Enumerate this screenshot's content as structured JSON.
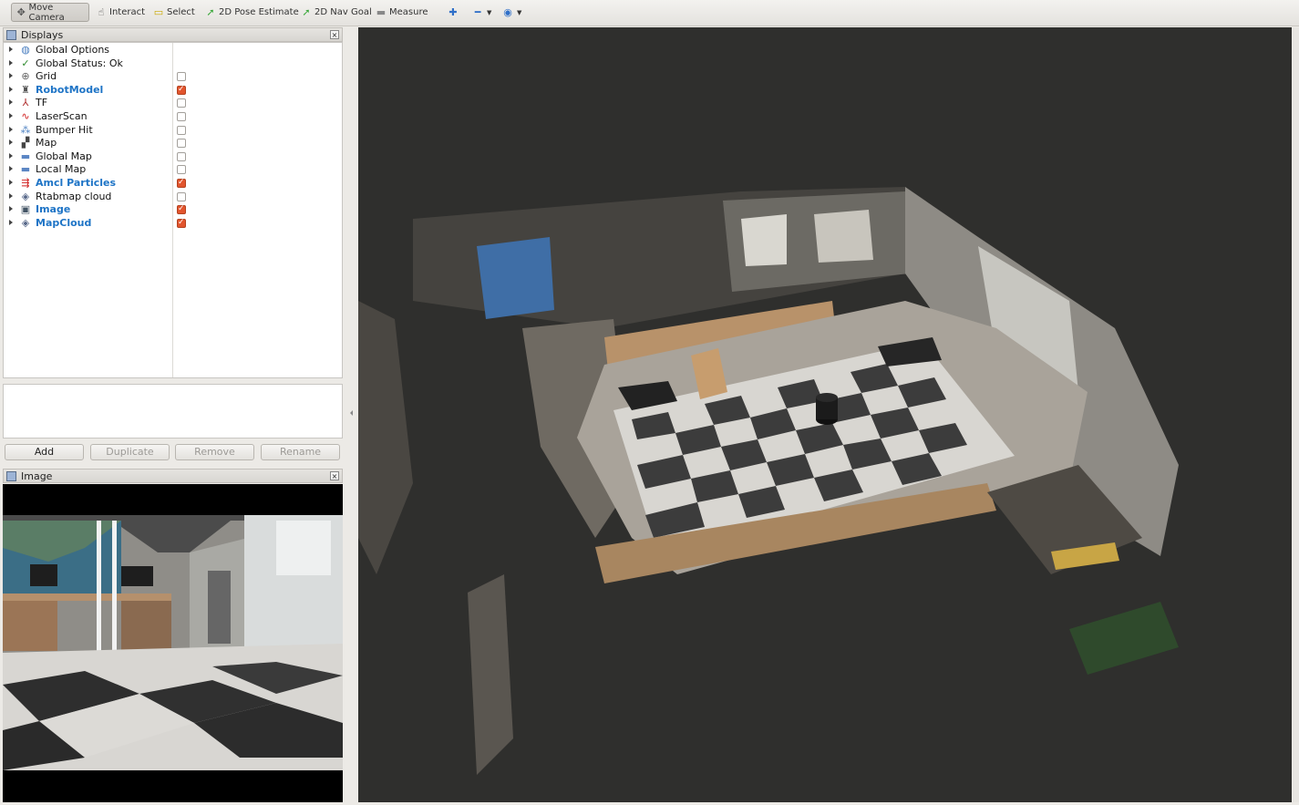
{
  "toolbar": {
    "tools": [
      {
        "label": "Move Camera",
        "icon": "move-camera-icon",
        "glyph": "✥",
        "color": "#555555",
        "active": true
      },
      {
        "label": "Interact",
        "icon": "interact-hand-icon",
        "glyph": "☝",
        "color": "#555555",
        "active": false
      },
      {
        "label": "Select",
        "icon": "select-rectangle-icon",
        "glyph": "▭",
        "color": "#c9a800",
        "active": false
      },
      {
        "label": "2D Pose Estimate",
        "icon": "pose-arrow-icon",
        "glyph": "➚",
        "color": "#3aa83a",
        "active": false
      },
      {
        "label": "2D Nav Goal",
        "icon": "nav-goal-arrow-icon",
        "glyph": "➚",
        "color": "#3aa83a",
        "active": false
      },
      {
        "label": "Measure",
        "icon": "measure-ruler-icon",
        "glyph": "▬",
        "color": "#888888",
        "active": false
      }
    ],
    "extra_icons": [
      {
        "icon": "add-tool-icon",
        "glyph": "✚",
        "color": "#2f6fc8"
      },
      {
        "icon": "remove-tool-icon",
        "glyph": "━",
        "color": "#2f6fc8"
      },
      {
        "icon": "view-eye-icon",
        "glyph": "◉",
        "color": "#2f6fc8"
      }
    ]
  },
  "displays_panel": {
    "title": "Displays",
    "items": [
      {
        "label": "Global Options",
        "icon": "globe-icon",
        "glyph": "◍",
        "color": "#4a7fc0",
        "checkbox": null,
        "highlight": false
      },
      {
        "label": "Global Status: Ok",
        "icon": "status-ok-icon",
        "glyph": "✓",
        "color": "#2d8a2d",
        "checkbox": null,
        "highlight": false
      },
      {
        "label": "Grid",
        "icon": "grid-icon",
        "glyph": "⊕",
        "color": "#666666",
        "checkbox": false,
        "highlight": false
      },
      {
        "label": "RobotModel",
        "icon": "robot-model-icon",
        "glyph": "♜",
        "color": "#555555",
        "checkbox": true,
        "highlight": true
      },
      {
        "label": "TF",
        "icon": "tf-icon",
        "glyph": "⅄",
        "color": "#b03030",
        "checkbox": false,
        "highlight": false
      },
      {
        "label": "LaserScan",
        "icon": "laser-scan-icon",
        "glyph": "∿",
        "color": "#d02020",
        "checkbox": false,
        "highlight": false
      },
      {
        "label": "Bumper Hit",
        "icon": "bumper-hit-icon",
        "glyph": "⁂",
        "color": "#4a7fc0",
        "checkbox": false,
        "highlight": false
      },
      {
        "label": "Map",
        "icon": "map-icon",
        "glyph": "▞",
        "color": "#444444",
        "checkbox": false,
        "highlight": false
      },
      {
        "label": "Global Map",
        "icon": "folder-icon",
        "glyph": "▬",
        "color": "#5b86c4",
        "checkbox": false,
        "highlight": false
      },
      {
        "label": "Local Map",
        "icon": "folder-icon",
        "glyph": "▬",
        "color": "#5b86c4",
        "checkbox": false,
        "highlight": false
      },
      {
        "label": "Amcl Particles",
        "icon": "particles-icon",
        "glyph": "⇶",
        "color": "#d02020",
        "checkbox": true,
        "highlight": true
      },
      {
        "label": "Rtabmap cloud",
        "icon": "point-cloud-icon",
        "glyph": "◈",
        "color": "#556688",
        "checkbox": false,
        "highlight": false
      },
      {
        "label": "Image",
        "icon": "image-display-icon",
        "glyph": "▣",
        "color": "#445566",
        "checkbox": true,
        "highlight": true
      },
      {
        "label": "MapCloud",
        "icon": "point-cloud-icon",
        "glyph": "◈",
        "color": "#556688",
        "checkbox": true,
        "highlight": true
      }
    ],
    "buttons": {
      "add": "Add",
      "duplicate": "Duplicate",
      "remove": "Remove",
      "rename": "Rename"
    }
  },
  "image_panel": {
    "title": "Image"
  },
  "colors": {
    "accent_blue": "#1e74c6",
    "checked_orange": "#e2552e",
    "viewport_bg": "#2f2f2d"
  }
}
